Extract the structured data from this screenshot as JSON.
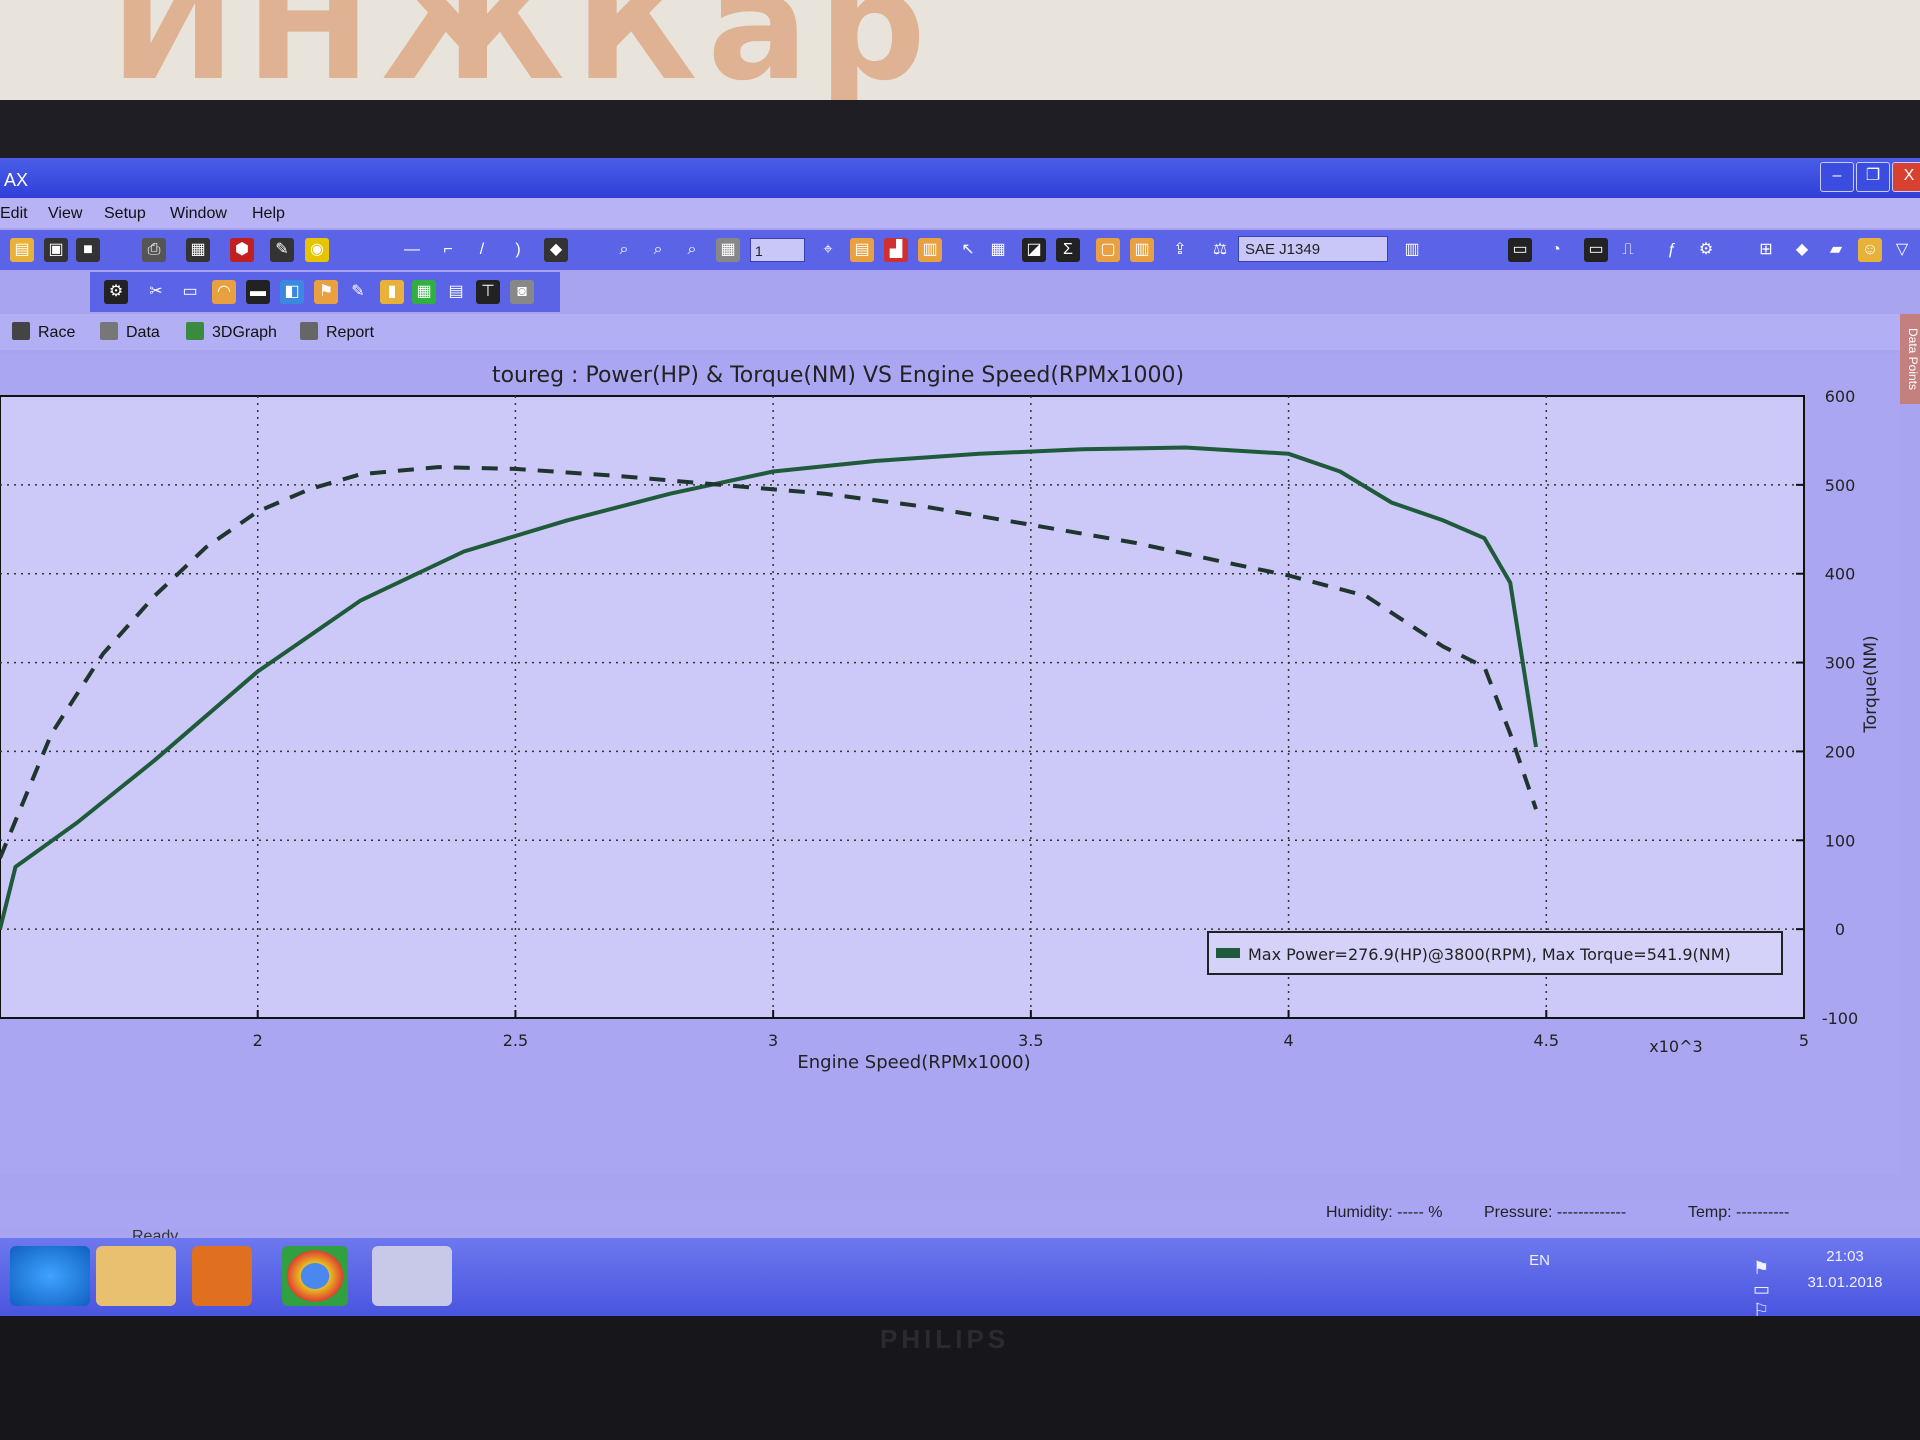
{
  "wall_sign": "ИНЖКар",
  "window": {
    "title": "AX",
    "minimize": "–",
    "maximize": "❐",
    "close": "X"
  },
  "menu": [
    "Edit",
    "View",
    "Setup",
    "Window",
    "Help"
  ],
  "toolbar": {
    "zoom_value": "1",
    "standard": "SAE J1349"
  },
  "tabs": [
    "Race",
    "Data",
    "3DGraph",
    "Report"
  ],
  "side_tab": "Data Points",
  "chart_data": {
    "type": "line",
    "title": "toureg : Power(HP) & Torque(NM) VS Engine Speed(RPMx1000)",
    "xlabel": "Engine Speed(RPMx1000)",
    "ylabel_right": "Torque(NM)",
    "x_multiplier_label": "x10^3",
    "xlim": [
      1.5,
      5.0
    ],
    "y_right_lim": [
      -100,
      600
    ],
    "x_ticks": [
      "2",
      "2.5",
      "3",
      "3.5",
      "4",
      "4.5",
      "5"
    ],
    "y_right_ticks": [
      "600",
      "500",
      "400",
      "300",
      "200",
      "100",
      "0",
      "-100"
    ],
    "grid": true,
    "legend_text": "Max Power=276.9(HP)@3800(RPM), Max Torque=541.9(NM)",
    "series": [
      {
        "style": "solid",
        "color": "#1f5a3a",
        "x": [
          1.5,
          1.53,
          1.65,
          1.8,
          2.0,
          2.2,
          2.4,
          2.6,
          2.8,
          3.0,
          3.2,
          3.4,
          3.6,
          3.8,
          4.0,
          4.1,
          4.2,
          4.3,
          4.38,
          4.43,
          4.48
        ],
        "y": [
          0,
          70,
          120,
          190,
          290,
          370,
          425,
          460,
          490,
          515,
          527,
          535,
          540,
          542,
          535,
          515,
          480,
          460,
          440,
          390,
          205
        ]
      },
      {
        "style": "dashed",
        "color": "#1f3530",
        "x": [
          1.5,
          1.6,
          1.7,
          1.8,
          1.9,
          2.0,
          2.1,
          2.2,
          2.35,
          2.5,
          2.7,
          2.9,
          3.1,
          3.3,
          3.5,
          3.7,
          3.9,
          4.0,
          4.15,
          4.3,
          4.38,
          4.43,
          4.48
        ],
        "y": [
          80,
          220,
          310,
          375,
          430,
          470,
          495,
          512,
          520,
          518,
          510,
          500,
          490,
          475,
          455,
          435,
          410,
          398,
          375,
          318,
          295,
          220,
          135
        ]
      }
    ]
  },
  "status": {
    "ready": "Ready",
    "humidity": "Humidity: ----- %",
    "pressure": "Pressure: -------------",
    "temp": "Temp: ----------"
  },
  "taskbar": {
    "lang": "EN",
    "time": "21:03",
    "date": "31.01.2018"
  },
  "monitor_brand": "PHILIPS"
}
